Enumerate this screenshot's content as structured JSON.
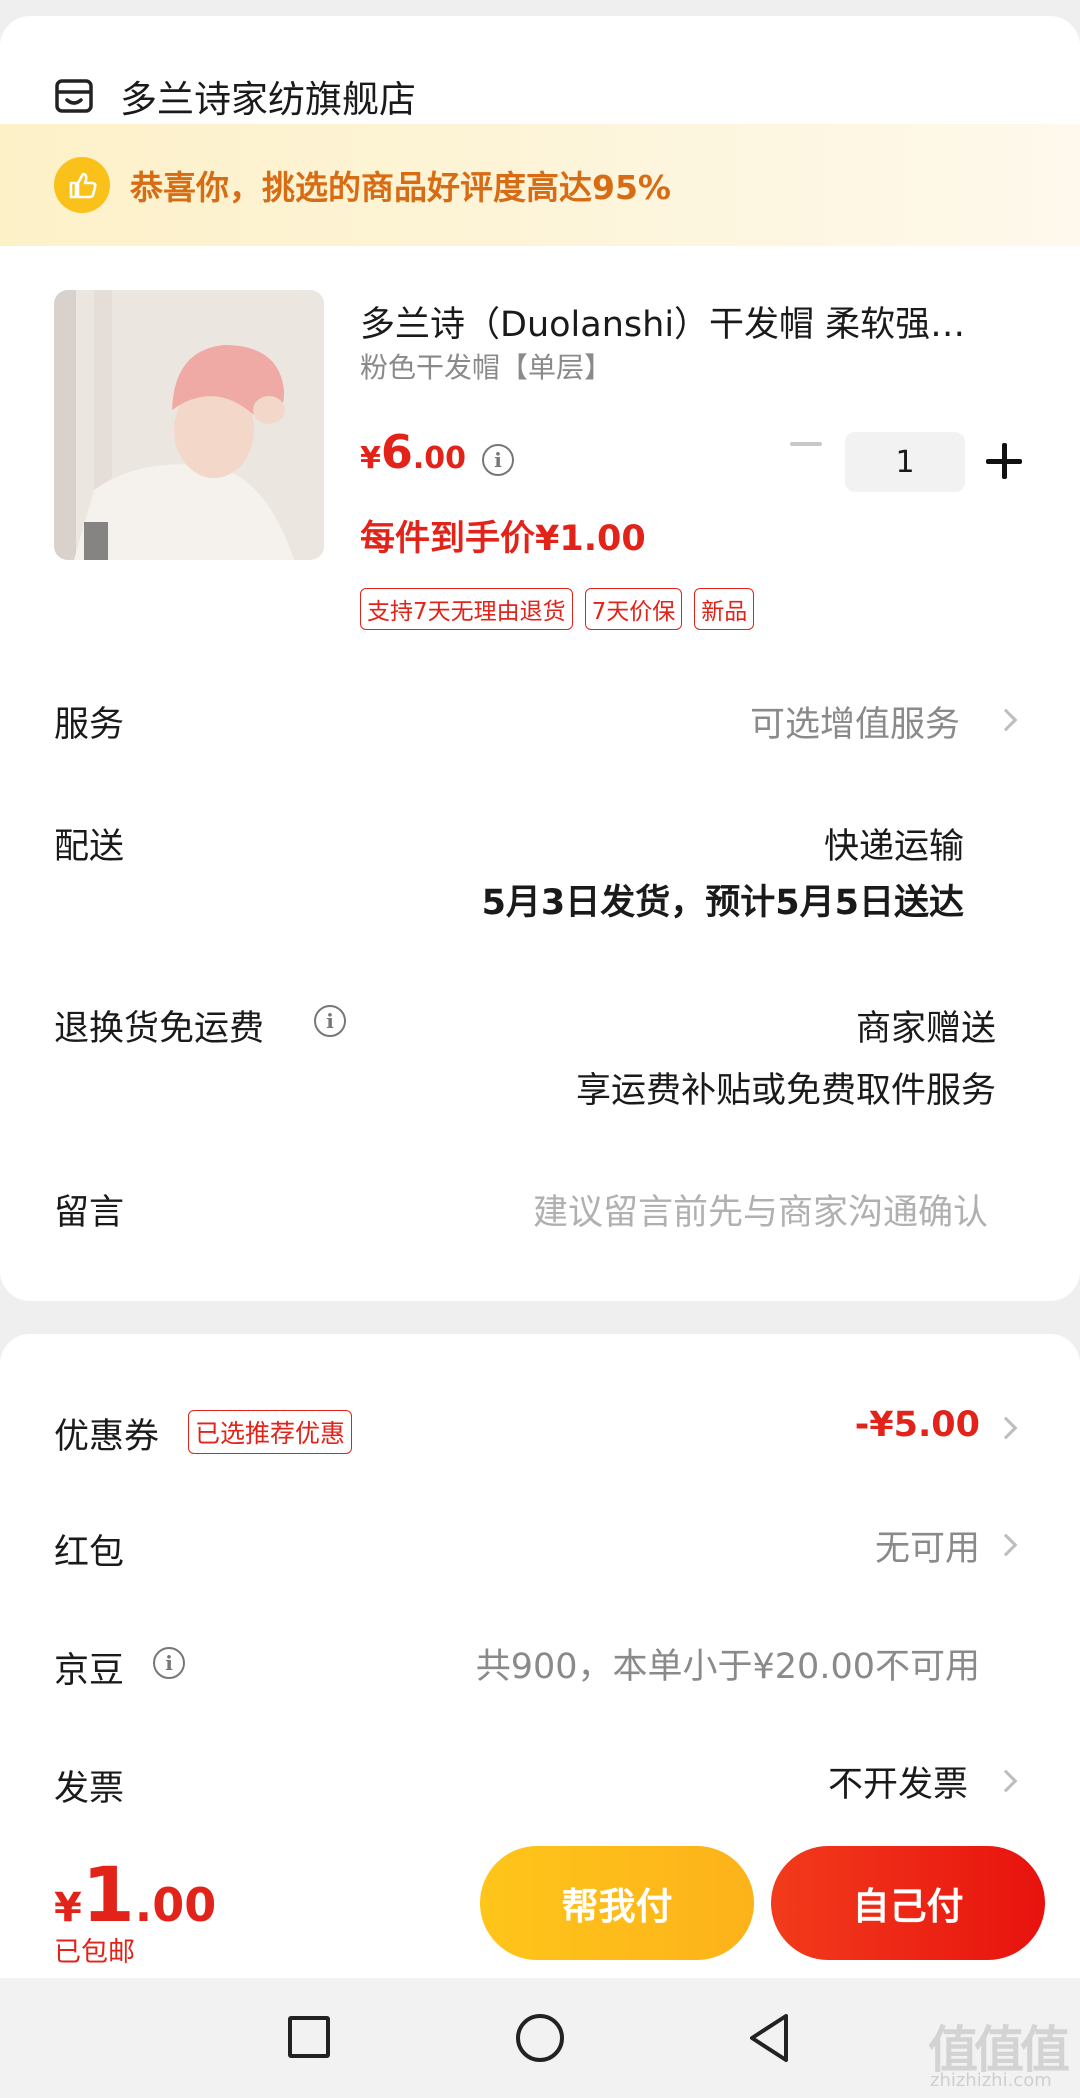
{
  "shop": {
    "name": "多兰诗家纺旗舰店",
    "icon": "store-icon"
  },
  "banner": {
    "text": "恭喜你，挑选的商品好评度高达95%",
    "icon": "thumbs-up-icon"
  },
  "product": {
    "title": "多兰诗（Duolanshi）干发帽 柔软强…",
    "spec": "粉色干发帽【单层】",
    "price_yen": "¥",
    "price_int": "6",
    "price_dec": ".00",
    "each_price": "每件到手价¥1.00",
    "tags": [
      "支持7天无理由退货",
      "7天价保",
      "新品"
    ],
    "quantity": "1"
  },
  "rows": {
    "service": {
      "label": "服务",
      "value": "可选增值服务"
    },
    "delivery": {
      "label": "配送",
      "method": "快递运输",
      "schedule": "5月3日发货，预计5月5日送达"
    },
    "return": {
      "label": "退换货免运费",
      "value1": "商家赠送",
      "value2": "享运费补贴或免费取件服务"
    },
    "message": {
      "label": "留言",
      "placeholder": "建议留言前先与商家沟通确认"
    }
  },
  "discounts": {
    "coupon": {
      "label": "优惠券",
      "badge": "已选推荐优惠",
      "value": "-¥5.00"
    },
    "redpacket": {
      "label": "红包",
      "value": "无可用"
    },
    "jingdou": {
      "label": "京豆",
      "value": "共900，本单小于¥20.00不可用"
    },
    "invoice": {
      "label": "发票",
      "value": "不开发票"
    }
  },
  "footer": {
    "total_yen": "¥",
    "total_int": "1",
    "total_dec": ".00",
    "shipping": "已包邮",
    "help_pay": "帮我付",
    "self_pay": "自己付"
  },
  "watermark": {
    "text": "值值值",
    "sub": "zhizhizhi.com"
  },
  "colors": {
    "accent_red": "#e2231a",
    "banner_orange": "#d76c15",
    "help_btn": "#fec51a"
  }
}
